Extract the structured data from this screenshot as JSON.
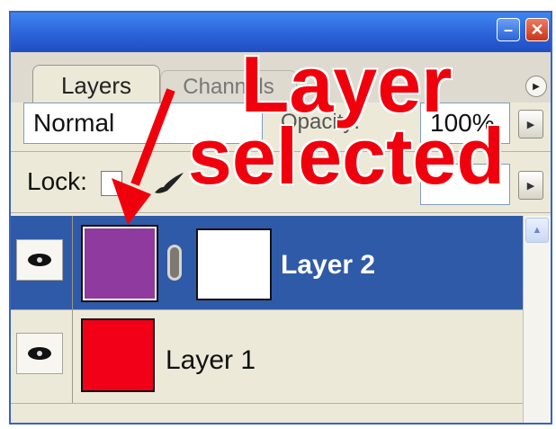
{
  "window": {
    "minimize_icon": "minimize-icon",
    "close_icon": "close-icon"
  },
  "tabs": [
    {
      "label": "Layers",
      "active": true
    },
    {
      "label": "Channels",
      "active": false
    }
  ],
  "blend_mode": {
    "value": "Normal"
  },
  "opacity": {
    "label": "Opacity:",
    "value": "100%"
  },
  "lock": {
    "label": "Lock:"
  },
  "layers": [
    {
      "name": "Layer 2",
      "selected": true,
      "thumb_color": "#8e3a9e",
      "has_mask": true,
      "visible": true
    },
    {
      "name": "Layer 1",
      "selected": false,
      "thumb_color": "#f20018",
      "has_mask": false,
      "visible": true
    }
  ],
  "annotation": {
    "line1": "Layer",
    "line2": "selected",
    "color": "#f0000c"
  },
  "colors": {
    "titlebar": "#2a5fd8",
    "selection": "#2f5aa8",
    "panel_bg": "#ece9d8"
  }
}
